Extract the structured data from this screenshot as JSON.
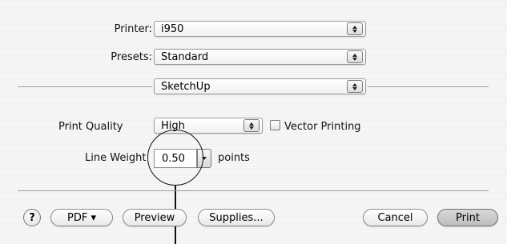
{
  "printer": {
    "label": "Printer:",
    "value": "i950"
  },
  "presets": {
    "label": "Presets:",
    "value": "Standard"
  },
  "panel_selector": {
    "value": "SketchUp"
  },
  "print_quality": {
    "label": "Print Quality",
    "value": "High"
  },
  "vector_printing": {
    "label": "Vector Printing",
    "checked": false
  },
  "line_weight": {
    "label": "Line Weight",
    "value": "0.50",
    "unit": "points"
  },
  "buttons": {
    "help": "?",
    "pdf": "PDF ▾",
    "preview": "Preview",
    "supplies": "Supplies...",
    "cancel": "Cancel",
    "print": "Print"
  },
  "icons": {
    "popup_arrows": "up-down-arrows-icon",
    "combo_arrow": "down-arrow-icon",
    "help": "help-icon"
  }
}
